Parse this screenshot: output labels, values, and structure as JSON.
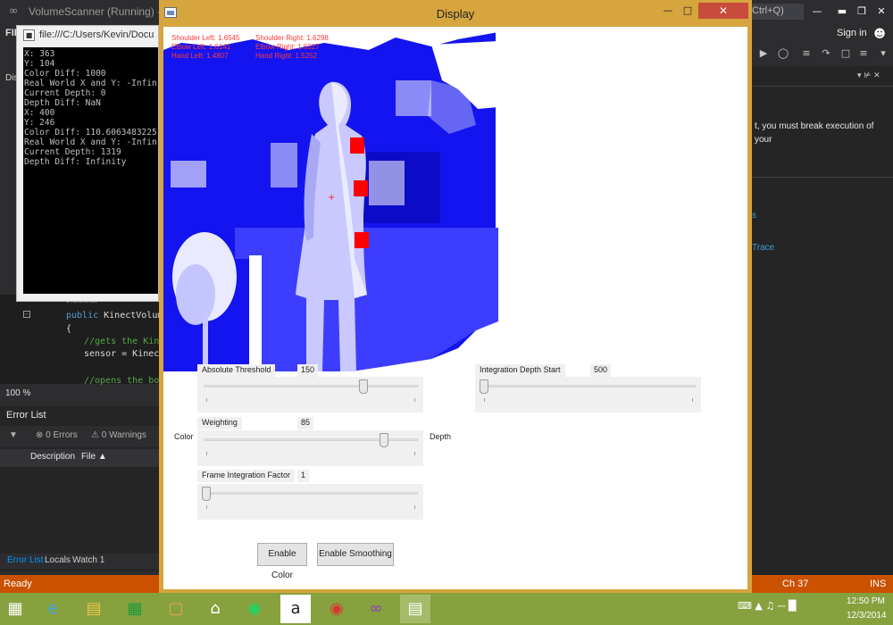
{
  "vs": {
    "title": "VolumeScanner (Running) - M",
    "quick_launch": "Ctrl+Q)",
    "menu_file": "FIL",
    "sign_in": "Sign in",
    "left_tab": "Dis",
    "code": {
      "ref": "1 reference",
      "line1_kw": "public",
      "line1_rest": " KinectVolumeS",
      "line2": "{",
      "line3": "//gets the Kinect",
      "line4": "sensor = KinectS",
      "line5": "//opens the body"
    },
    "zoom": "100 %",
    "error_list": {
      "title": "Error List",
      "errors": "0 Errors",
      "warnings": "0 Warnings",
      "col_description": "Description",
      "col_file": "File"
    },
    "bottom_tabs": {
      "error_list": "Error List",
      "locals": "Locals",
      "watch": "Watch 1"
    },
    "right_panel": {
      "message": "t, you must break execution of your",
      "link1": "s",
      "link2": "Trace"
    },
    "status": {
      "ready": "Ready",
      "ch": "Ch 37",
      "ins": "INS"
    }
  },
  "console": {
    "title": "file:///C:/Users/Kevin/Docu",
    "lines": [
      "X: 363",
      "Y: 104",
      "Color Diff: 1000",
      "Real World X and Y: -Infin",
      "Current Depth: 0",
      "Depth Diff: NaN",
      "X: 400",
      "Y: 246",
      "Color Diff: 110.6063483225",
      "Real World X and Y: -Infin",
      "Current Depth: 1319",
      "Depth Diff: Infinity"
    ]
  },
  "display": {
    "title": "Display",
    "joints": {
      "shoulder_left": "Shoulder Left: 1.6545",
      "elbow_left": "Elbow Left: 1.6141",
      "hand_left": "Hand Left: 1.4807",
      "shoulder_right": "Shoulder Right: 1.6298",
      "elbow_right": "Elbow Right: 1.6327",
      "hand_right": "Hand Right: 1.5252"
    },
    "controls": {
      "absolute_threshold": {
        "label": "Absolute Threshold",
        "value": "150",
        "fraction": 0.75
      },
      "weighting": {
        "label": "Weighting",
        "value": "85",
        "fraction": 0.85
      },
      "frame_integration": {
        "label": "Frame Integration Factor",
        "value": "1",
        "fraction": 0.0
      },
      "integration_depth": {
        "label": "Integration Depth Start",
        "value": "500",
        "fraction": 0.0
      },
      "color_label": "Color",
      "depth_label": "Depth"
    },
    "buttons": {
      "enable_color": "Enable Color",
      "enable_smoothing": "Enable Smoothing"
    }
  },
  "taskbar": {
    "apps": [
      "windows-store",
      "internet-explorer",
      "file-explorer",
      "excel",
      "notes",
      "home",
      "spotify",
      "amazon",
      "chrome",
      "visual-studio",
      "display-app"
    ],
    "time": "12:50 PM",
    "date": "12/3/2014"
  },
  "colors": {
    "vs_status": "#ca5100",
    "display_frame": "#d6a53e",
    "depth_blue": "#1414f0",
    "joint_red": "#ff0000",
    "taskbar": "#87a13f"
  }
}
